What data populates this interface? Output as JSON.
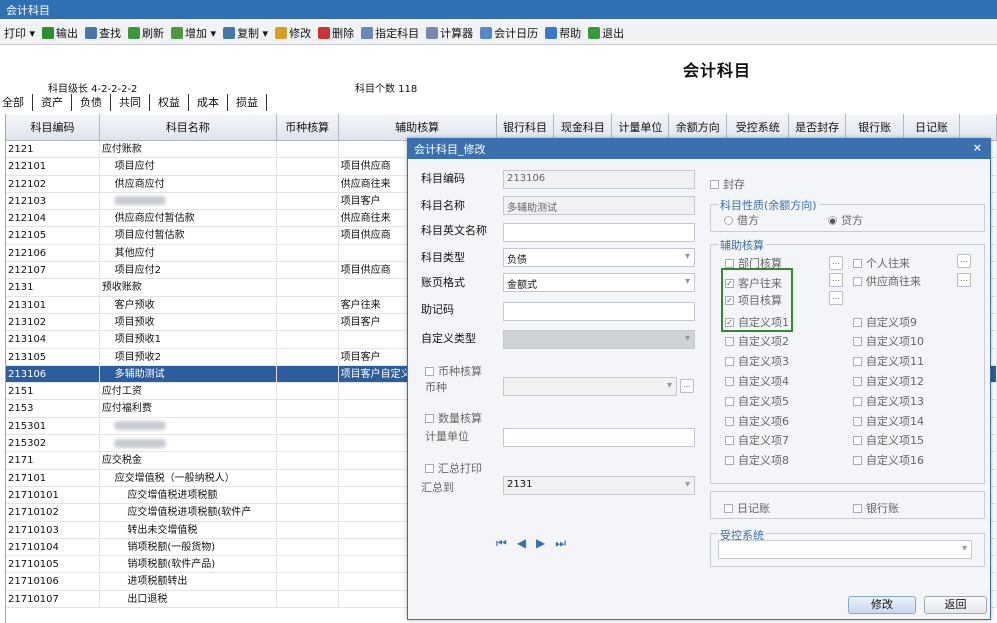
{
  "window": {
    "title": "会计科目"
  },
  "toolbar": [
    {
      "label": "打印 ▾",
      "icon": "print-icon"
    },
    {
      "label": "输出",
      "icon": "export-icon",
      "color": "#2a8f2a"
    },
    {
      "label": "查找",
      "icon": "find-icon",
      "color": "#4477aa"
    },
    {
      "label": "刷新",
      "icon": "refresh-icon",
      "color": "#3a9a3a"
    },
    {
      "label": "增加 ▾",
      "icon": "add-icon",
      "color": "#4d9a3e"
    },
    {
      "label": "复制 ▾",
      "icon": "copy-icon",
      "color": "#4477aa"
    },
    {
      "label": "修改",
      "icon": "edit-icon",
      "color": "#d8a020"
    },
    {
      "label": "删除",
      "icon": "delete-icon",
      "color": "#cc3333"
    },
    {
      "label": "指定科目",
      "icon": "specify-icon",
      "color": "#6688bb"
    },
    {
      "label": "计算器",
      "icon": "calculator-icon",
      "color": "#7788aa"
    },
    {
      "label": "会计日历",
      "icon": "calendar-icon",
      "color": "#5588cc"
    },
    {
      "label": "帮助",
      "icon": "help-icon",
      "color": "#3a77cc"
    },
    {
      "label": "退出",
      "icon": "exit-icon",
      "color": "#3a9a3a"
    }
  ],
  "page": {
    "title": "会计科目",
    "level": "科目级长 4-2-2-2-2",
    "count": "科目个数 118"
  },
  "tabs": [
    "全部",
    "资产",
    "负债",
    "共同",
    "权益",
    "成本",
    "损益"
  ],
  "grid": {
    "headers": [
      "科目编码",
      "科目名称",
      "币种核算",
      "辅助核算",
      "银行科目",
      "现金科目",
      "计量单位",
      "余额方向",
      "受控系统",
      "是否封存",
      "银行账",
      "日记账"
    ],
    "rows": [
      {
        "code": "2121",
        "name": "应付账款",
        "aux": ""
      },
      {
        "code": "212101",
        "name": "    项目应付",
        "aux": "项目供应商"
      },
      {
        "code": "212102",
        "name": "    供应商应付",
        "aux": "供应商往来"
      },
      {
        "code": "212103",
        "name": "",
        "aux": "项目客户",
        "blur": true
      },
      {
        "code": "212104",
        "name": "    供应商应付暂估款",
        "aux": "供应商往来"
      },
      {
        "code": "212105",
        "name": "    项目应付暂估款",
        "aux": "项目供应商"
      },
      {
        "code": "212106",
        "name": "    其他应付",
        "aux": ""
      },
      {
        "code": "212107",
        "name": "    项目应付2",
        "aux": "项目供应商"
      },
      {
        "code": "2131",
        "name": "预收账款",
        "aux": ""
      },
      {
        "code": "213101",
        "name": "    客户预收",
        "aux": "客户往来"
      },
      {
        "code": "213102",
        "name": "    项目预收",
        "aux": "项目客户"
      },
      {
        "code": "213104",
        "name": "    项目预收1",
        "aux": ""
      },
      {
        "code": "213105",
        "name": "    项目预收2",
        "aux": "项目客户"
      },
      {
        "code": "213106",
        "name": "    多辅助测试",
        "aux": "项目客户自定义",
        "selected": true
      },
      {
        "code": "2151",
        "name": "应付工资",
        "aux": ""
      },
      {
        "code": "2153",
        "name": "应付福利费",
        "aux": ""
      },
      {
        "code": "215301",
        "name": "",
        "aux": "",
        "blur": true
      },
      {
        "code": "215302",
        "name": "",
        "aux": "",
        "blur": true
      },
      {
        "code": "2171",
        "name": "应交税金",
        "aux": ""
      },
      {
        "code": "217101",
        "name": "    应交增值税（一般纳税人）",
        "aux": ""
      },
      {
        "code": "21710101",
        "name": "        应交增值税进项税额",
        "aux": ""
      },
      {
        "code": "21710102",
        "name": "        应交增值税进项税额(软件产",
        "aux": ""
      },
      {
        "code": "21710103",
        "name": "        转出未交增值税",
        "aux": ""
      },
      {
        "code": "21710104",
        "name": "        销项税额(一般货物)",
        "aux": ""
      },
      {
        "code": "21710105",
        "name": "        销项税额(软件产品)",
        "aux": ""
      },
      {
        "code": "21710106",
        "name": "        进项税额转出",
        "aux": ""
      },
      {
        "code": "21710107",
        "name": "        出口退税",
        "aux": ""
      }
    ]
  },
  "dialog": {
    "title": "会计科目_修改",
    "labels": {
      "code": "科目编码",
      "name": "科目名称",
      "en_name": "科目英文名称",
      "type": "科目类型",
      "format": "账页格式",
      "mnemonic": "助记码",
      "custom_type": "自定义类型",
      "currency_check": "币种核算",
      "currency": "币种",
      "qty_check": "数量核算",
      "unit": "计量单位",
      "summary_check": "汇总打印",
      "summary_to": "汇总到"
    },
    "values": {
      "code": "213106",
      "name": "多辅助测试",
      "en_name": "",
      "type": "负债",
      "format": "金额式",
      "mnemonic": "",
      "custom_type": "",
      "currency": "",
      "unit": "",
      "summary_to": "2131"
    },
    "seal": "封存",
    "nature_legend": "科目性质(余额方向)",
    "debit": "借方",
    "credit": "贷方",
    "aux_legend": "辅助核算",
    "aux_left": [
      {
        "label": "部门核算",
        "checked": false
      },
      {
        "label": "客户往来",
        "checked": true
      },
      {
        "label": "项目核算",
        "checked": true
      },
      {
        "label": "自定义项1",
        "checked": true
      },
      {
        "label": "自定义项2",
        "checked": false
      },
      {
        "label": "自定义项3",
        "checked": false
      },
      {
        "label": "自定义项4",
        "checked": false
      },
      {
        "label": "自定义项5",
        "checked": false
      },
      {
        "label": "自定义项6",
        "checked": false
      },
      {
        "label": "自定义项7",
        "checked": false
      },
      {
        "label": "自定义项8",
        "checked": false
      }
    ],
    "aux_right": [
      {
        "label": "个人往来",
        "checked": false
      },
      {
        "label": "供应商往来",
        "checked": false
      },
      {
        "label": "自定义项9",
        "checked": false
      },
      {
        "label": "自定义项10",
        "checked": false
      },
      {
        "label": "自定义项11",
        "checked": false
      },
      {
        "label": "自定义项12",
        "checked": false
      },
      {
        "label": "自定义项13",
        "checked": false
      },
      {
        "label": "自定义项14",
        "checked": false
      },
      {
        "label": "自定义项15",
        "checked": false
      },
      {
        "label": "自定义项16",
        "checked": false
      }
    ],
    "journal": "日记账",
    "bank_book": "银行账",
    "controlled_legend": "受控系统",
    "buttons": {
      "modify": "修改",
      "back": "返回"
    },
    "nav": [
      "⏮",
      "◀",
      "▶",
      "⏭"
    ],
    "highlight_color": "#2e8b2e"
  }
}
